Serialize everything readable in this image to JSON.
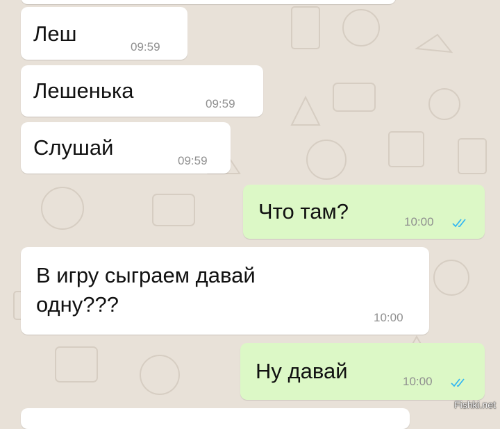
{
  "chat": {
    "messages": [
      {
        "direction": "incoming",
        "text": "Леш",
        "time": "09:59"
      },
      {
        "direction": "incoming",
        "text": "Лешенька",
        "time": "09:59"
      },
      {
        "direction": "incoming",
        "text": "Слушай",
        "time": "09:59"
      },
      {
        "direction": "outgoing",
        "text": "Что там?",
        "time": "10:00",
        "status": "read"
      },
      {
        "direction": "incoming",
        "text_line1": "В игру сыграем давай",
        "text_line2": "одну???",
        "time": "10:00"
      },
      {
        "direction": "outgoing",
        "text": "Ну давай",
        "time": "10:00",
        "status": "read"
      }
    ]
  },
  "watermark": "Fishki.net",
  "colors": {
    "background": "#e8e1d8",
    "incoming_bubble": "#ffffff",
    "outgoing_bubble": "#dcf8c6",
    "read_ticks": "#34b7f1"
  },
  "icons": {
    "read_receipt": "double-check-icon"
  }
}
